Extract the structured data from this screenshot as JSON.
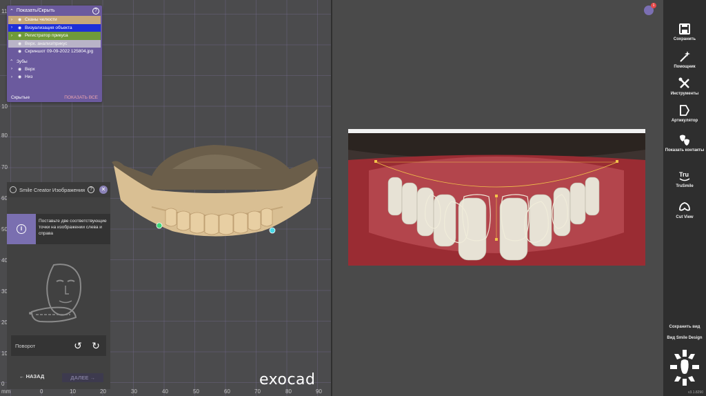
{
  "viewport": {
    "y_ticks": [
      "11",
      "10",
      "90",
      "80",
      "70",
      "60",
      "50",
      "40",
      "30",
      "20",
      "10",
      "0"
    ],
    "x_ticks": [
      "mm",
      "0",
      "10",
      "20",
      "30",
      "40",
      "50",
      "60",
      "70",
      "80",
      "90"
    ],
    "logo": "exocad"
  },
  "visibility_panel": {
    "title": "Показать/Скрыть",
    "rows": [
      {
        "label": "Сканы челюсти",
        "bg": "#c6a779"
      },
      {
        "label": "Визуализация объекта",
        "bg": "#1e2fd8"
      },
      {
        "label": "Регистратор прикуса",
        "bg": "#6f9a3a"
      },
      {
        "label": "Верх. анализ/прикус",
        "bg": "#b9b4c8"
      },
      {
        "label": "Скриншот 09-09-2022 125804.jpg",
        "bg": ""
      }
    ],
    "teeth_section": "Зубы",
    "teeth_rows": [
      "Верх",
      "Низ"
    ],
    "hidden_label": "Скрытые",
    "show_all": "ПОКАЗАТЬ ВСЕ"
  },
  "smile_panel": {
    "title": "Smile Creator Изображения",
    "instruction": "Поставьте две соответствующие точки на изображении слева и справа",
    "rotation_label": "Поворот",
    "back_label": "НАЗАД",
    "next_label": "ДАЛЕЕ"
  },
  "notification": {
    "count": "1"
  },
  "window_controls": {
    "minimize": "–",
    "maximize": "□",
    "close": "✕"
  },
  "toolbar": {
    "items": [
      {
        "label": "Сохранить",
        "icon": "save-icon"
      },
      {
        "label": "Помощник",
        "icon": "wizard-icon"
      },
      {
        "label": "Инструменты",
        "icon": "tools-icon"
      },
      {
        "label": "Артикулятор",
        "icon": "articulator-icon"
      },
      {
        "label": "Показать контакты",
        "icon": "contacts-icon"
      },
      {
        "label": "TruSmile",
        "icon": "trusmile-icon"
      },
      {
        "label": "Cut View",
        "icon": "cut-view-icon"
      }
    ],
    "save_view": "Сохранить вид",
    "smile_design_view": "Вид Smile Design",
    "version": "v3.1.8290"
  },
  "colors": {
    "accent": "#7a6fb0",
    "toolbar_bg": "#2e2e2e",
    "viewport_bg": "#4b4b4d"
  }
}
